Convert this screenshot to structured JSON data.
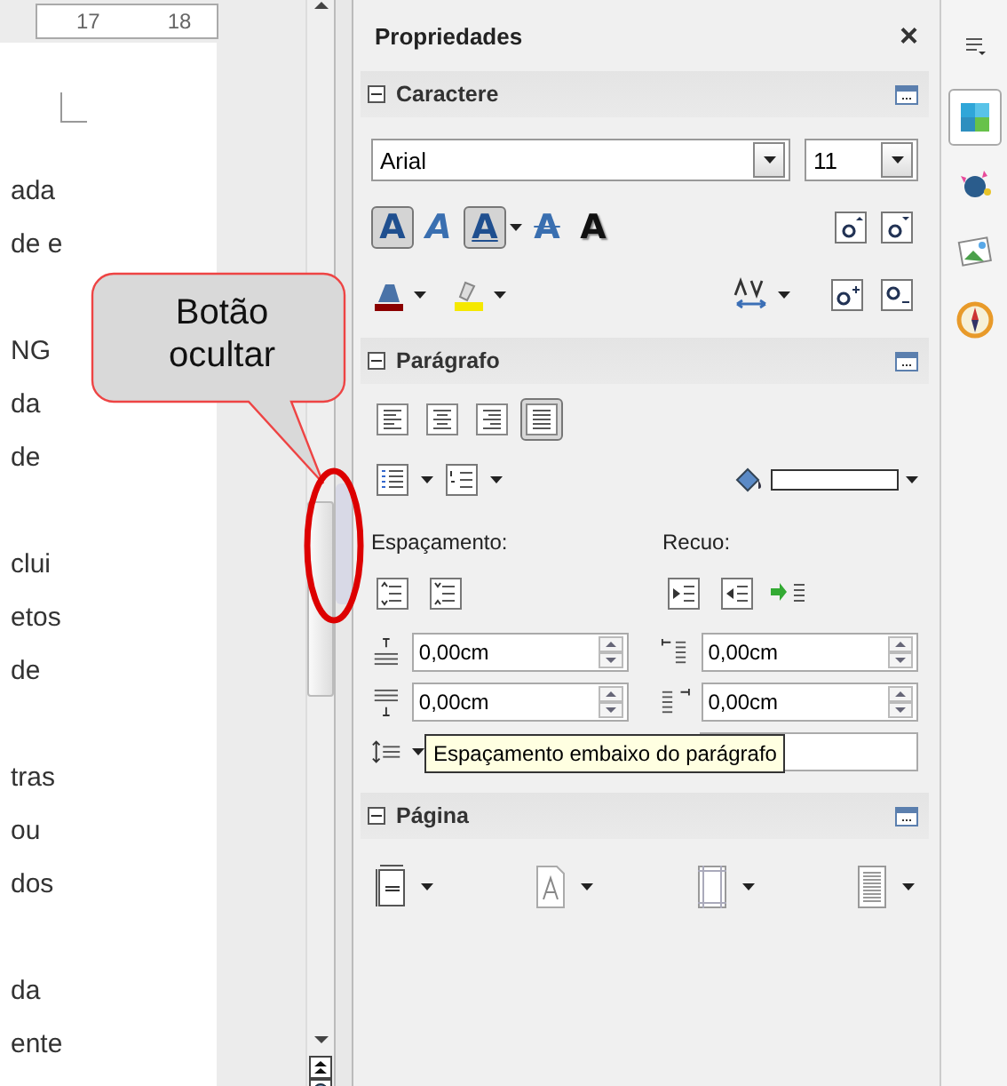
{
  "document": {
    "ruler_labels": [
      "17",
      "18"
    ],
    "paragraphs": [
      [
        "ada",
        "de e"
      ],
      [
        "NG",
        "da",
        "de"
      ],
      [
        "clui",
        "etos",
        "de"
      ],
      [
        "tras",
        "ou",
        "dos"
      ],
      [
        "da",
        "ente"
      ]
    ]
  },
  "callout": {
    "text": "Botão ocultar"
  },
  "panel": {
    "title": "Propriedades",
    "close": "×",
    "sections": [
      {
        "kind": "character",
        "title": "Caractere",
        "expanded": true,
        "font": "Arial",
        "size": "11",
        "styles": [
          {
            "glyph": "A",
            "kind": "bold",
            "selected": true
          },
          {
            "glyph": "A",
            "kind": "italic",
            "selected": false
          },
          {
            "glyph": "A",
            "kind": "underline",
            "selected": true
          },
          {
            "glyph": "A",
            "kind": "strike",
            "selected": false
          },
          {
            "glyph": "A",
            "kind": "shadow",
            "selected": false
          }
        ]
      },
      {
        "kind": "paragraph",
        "title": "Parágrafo",
        "expanded": true,
        "alignments": [
          {
            "kind": "left",
            "selected": false
          },
          {
            "kind": "center",
            "selected": false
          },
          {
            "kind": "right",
            "selected": false
          },
          {
            "kind": "justify",
            "selected": true
          }
        ],
        "spacing_label": "Espaçamento:",
        "indent_label": "Recuo:",
        "above": "0,00cm",
        "below": "0,00cm",
        "before_indent": "0,00cm",
        "after_indent": "0,00cm"
      },
      {
        "kind": "page",
        "title": "Página",
        "expanded": true
      }
    ],
    "tooltip": "Espaçamento embaixo do parágrafo"
  },
  "tabs": [
    {
      "kind": "properties",
      "selected": true
    },
    {
      "kind": "styles",
      "selected": false
    },
    {
      "kind": "gallery",
      "selected": false
    },
    {
      "kind": "navigator",
      "selected": false
    }
  ]
}
